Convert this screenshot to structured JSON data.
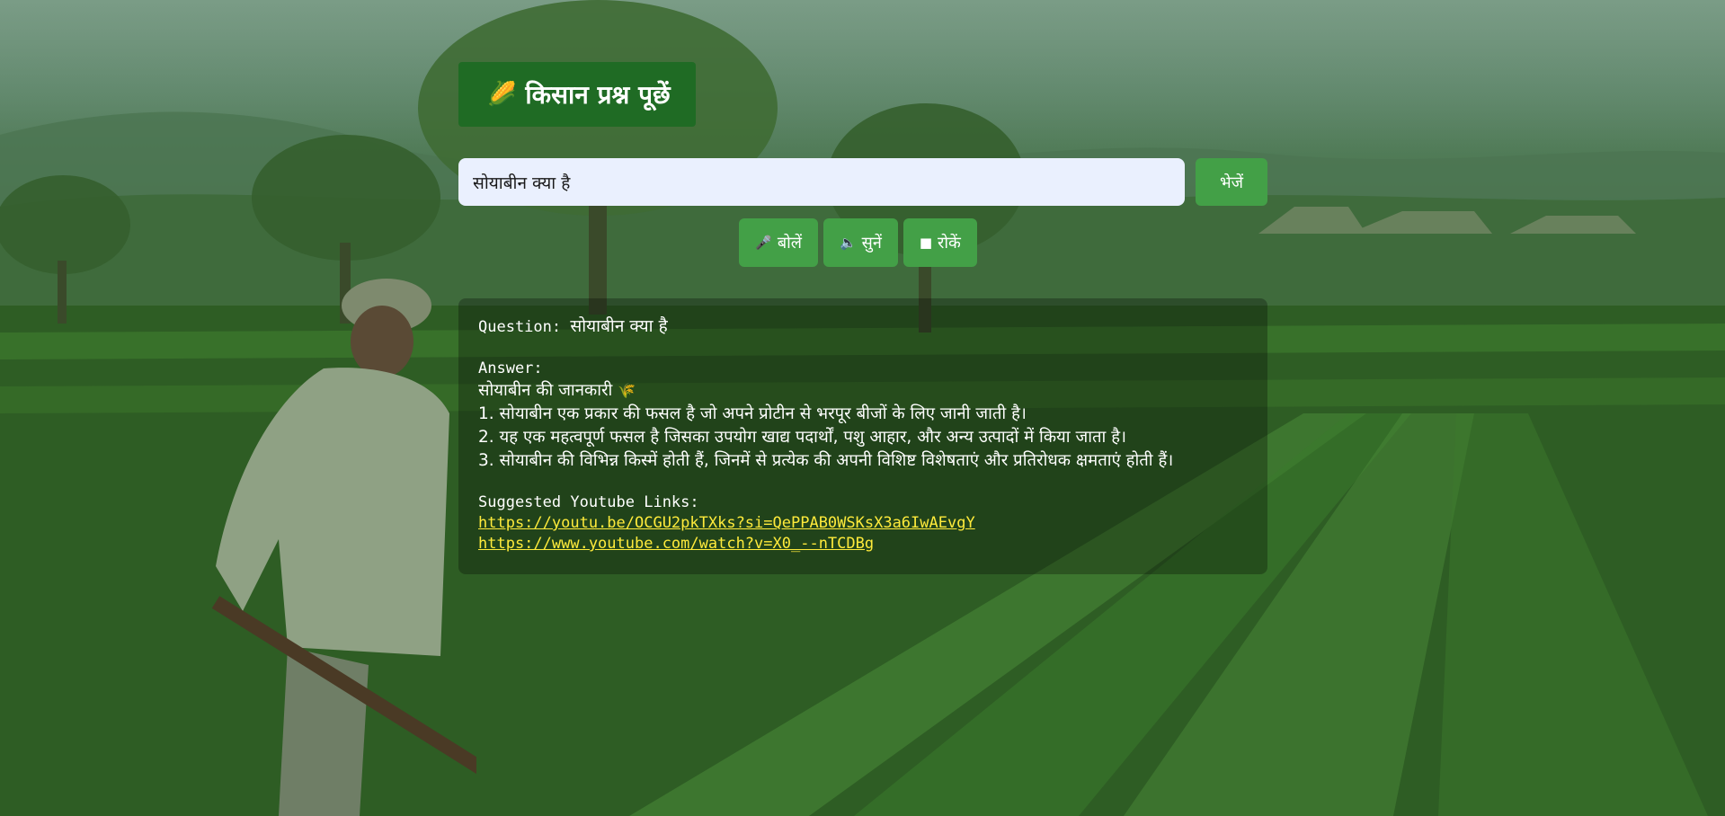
{
  "header": {
    "icon": "corn-icon",
    "title": "किसान प्रश्न पूछें"
  },
  "search": {
    "value": "सोयाबीन क्या है",
    "send_label": "भेजें"
  },
  "voice_controls": [
    {
      "icon": "microphone-icon",
      "glyph": "🎤",
      "label": "बोलें"
    },
    {
      "icon": "speaker-icon",
      "glyph": "🔈",
      "label": "सुनें"
    },
    {
      "icon": "stop-icon",
      "glyph": "■",
      "label": "रोकें"
    }
  ],
  "answer_panel": {
    "question_label": "Question:",
    "question_text": "सोयाबीन क्या है",
    "answer_label": "Answer:",
    "answer_heading": "सोयाबीन की जानकारी",
    "answer_heading_icon": "🌾",
    "answer_points": [
      "1. सोयाबीन एक प्रकार की फसल है जो अपने प्रोटीन से भरपूर बीजों के लिए जानी जाती है।",
      "2. यह एक महत्वपूर्ण फसल है जिसका उपयोग खाद्य पदार्थों, पशु आहार, और अन्य उत्पादों में किया जाता है।",
      "3. सोयाबीन की विभिन्न किस्में होती हैं, जिनमें से प्रत्येक की अपनी विशिष्ट विशेषताएं और प्रतिरोधक क्षमताएं होती हैं।"
    ],
    "links_label": "Suggested Youtube Links:",
    "links": [
      "https://youtu.be/OCGU2pkTXks?si=QePPAB0WSKsX3a6IwAEvgY",
      "https://www.youtube.com/watch?v=X0_--nTCDBg"
    ]
  },
  "colors": {
    "title_bg": "#1f6b24",
    "button_bg": "#43a047",
    "input_bg": "#eaf0fe",
    "link": "#ffeb3b"
  }
}
